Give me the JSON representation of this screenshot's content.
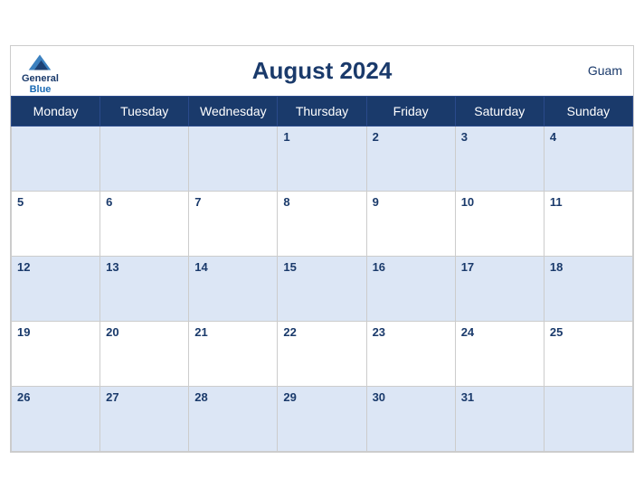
{
  "header": {
    "title": "August 2024",
    "logo_general": "General",
    "logo_blue": "Blue",
    "region": "Guam"
  },
  "weekdays": [
    "Monday",
    "Tuesday",
    "Wednesday",
    "Thursday",
    "Friday",
    "Saturday",
    "Sunday"
  ],
  "weeks": [
    [
      null,
      null,
      null,
      1,
      2,
      3,
      4
    ],
    [
      5,
      6,
      7,
      8,
      9,
      10,
      11
    ],
    [
      12,
      13,
      14,
      15,
      16,
      17,
      18
    ],
    [
      19,
      20,
      21,
      22,
      23,
      24,
      25
    ],
    [
      26,
      27,
      28,
      29,
      30,
      31,
      null
    ]
  ]
}
